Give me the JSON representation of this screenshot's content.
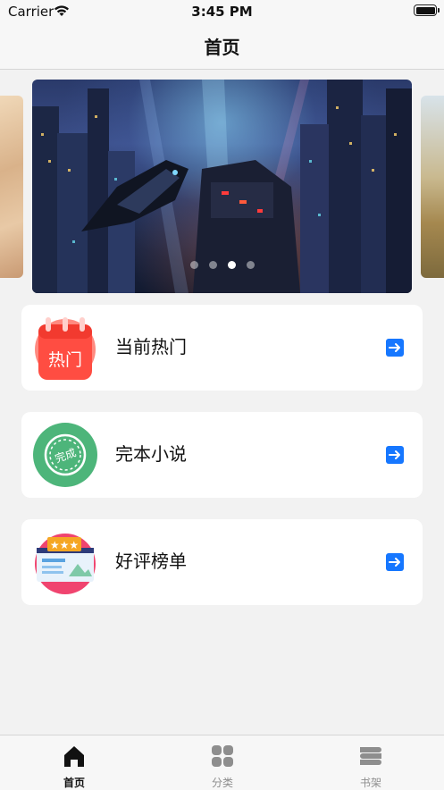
{
  "status_bar": {
    "carrier": "Carrier",
    "time": "3:45 PM"
  },
  "nav": {
    "title": "首页"
  },
  "banner": {
    "slide_count": 4,
    "active_index": 2
  },
  "menu": [
    {
      "label": "当前热门",
      "icon": "calendar-hot-icon",
      "icon_text": "热门",
      "accent": "#ff5a4e"
    },
    {
      "label": "完本小说",
      "icon": "completed-stamp-icon",
      "icon_text": "完成",
      "accent": "#4db57a"
    },
    {
      "label": "好评榜单",
      "icon": "rating-board-icon",
      "icon_text": "★★★",
      "accent": "#f0446f"
    }
  ],
  "tabs": [
    {
      "label": "首页",
      "icon": "home-icon",
      "active": true
    },
    {
      "label": "分类",
      "icon": "category-grid-icon",
      "active": false
    },
    {
      "label": "书架",
      "icon": "bookshelf-icon",
      "active": false
    }
  ],
  "colors": {
    "arrow_button": "#1677ff",
    "tab_active": "#111111",
    "tab_inactive": "#8e8e8e"
  }
}
